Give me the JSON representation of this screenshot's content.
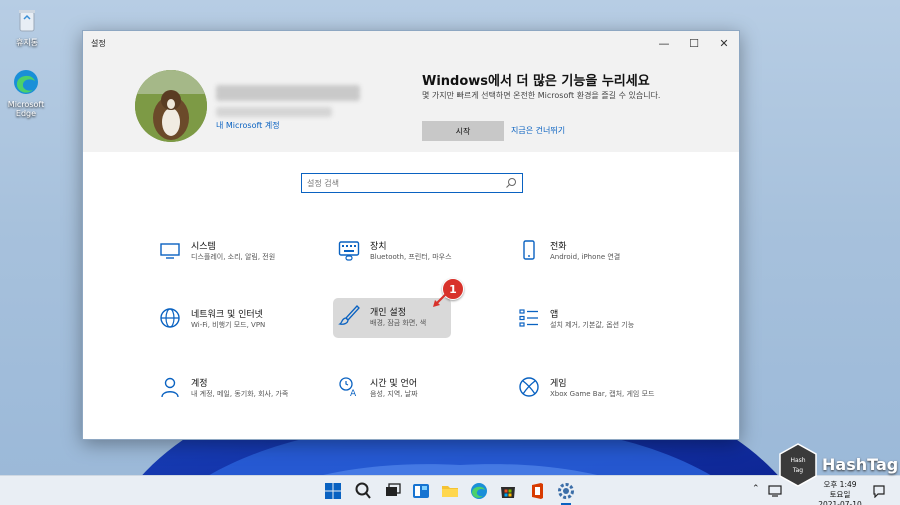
{
  "desktop": {
    "icons": [
      {
        "label": "휴지통"
      },
      {
        "label": "Microsoft Edge"
      }
    ]
  },
  "window": {
    "title": "설정",
    "controls": {
      "minimize": "—",
      "maximize": "☐",
      "close": "✕"
    }
  },
  "header": {
    "account_link": "내 Microsoft 계정",
    "promo_title": "Windows에서 더 많은 기능을 누리세요",
    "promo_text": "몇 가지만 빠르게 선택하면 온전한 Microsoft 환경을 즐길 수 있습니다.",
    "start_label": "시작",
    "skip_label": "지금은 건너뛰기"
  },
  "search": {
    "placeholder": "설정 검색",
    "icon": "search-icon"
  },
  "categories": [
    {
      "name": "시스템",
      "desc": "디스플레이, 소리, 알림, 전원",
      "icon": "display-icon"
    },
    {
      "name": "장치",
      "desc": "Bluetooth, 프린터, 마우스",
      "icon": "keyboard-icon"
    },
    {
      "name": "전화",
      "desc": "Android, iPhone 연결",
      "icon": "phone-icon"
    },
    {
      "name": "네트워크 및 인터넷",
      "desc": "Wi-Fi, 비행기 모드, VPN",
      "icon": "globe-icon"
    },
    {
      "name": "개인 설정",
      "desc": "배경, 잠금 화면, 색",
      "icon": "brush-icon"
    },
    {
      "name": "앱",
      "desc": "설치 제거, 기본값, 옵션 기능",
      "icon": "apps-list-icon"
    },
    {
      "name": "계정",
      "desc": "내 계정, 메일, 동기화, 회사, 가족",
      "icon": "person-icon"
    },
    {
      "name": "시간 및 언어",
      "desc": "음성, 지역, 날짜",
      "icon": "time-language-icon"
    },
    {
      "name": "게임",
      "desc": "Xbox Game Bar, 캡처, 게임 모드",
      "icon": "xbox-icon"
    }
  ],
  "annotation": {
    "badge": "1"
  },
  "taskbar": {
    "clock_time": "오후 1:49",
    "clock_day": "토요일",
    "clock_date": "2021-07-10"
  },
  "watermark": {
    "text": "HashTag"
  },
  "colors": {
    "accent": "#0a62c1",
    "badge": "#d8322b"
  }
}
